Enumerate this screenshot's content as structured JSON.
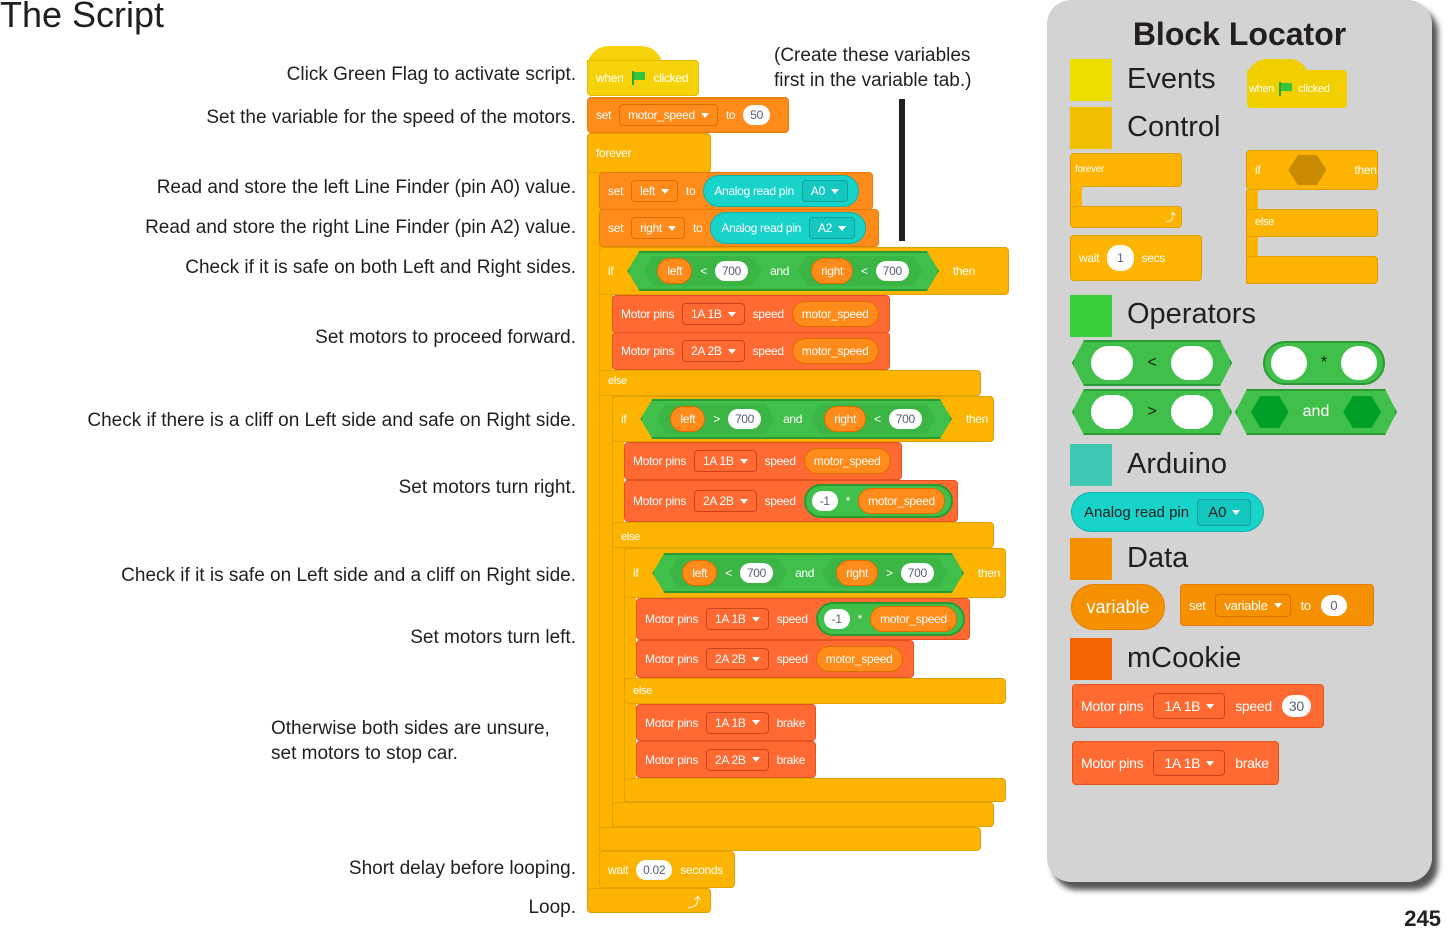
{
  "page": {
    "title": "The Script",
    "page_number": "245"
  },
  "note": {
    "line1": "(Create these variables",
    "line2": "first in the variable tab.)"
  },
  "annotations": [
    "Click Green Flag to activate script.",
    "Set the variable for the speed of the motors.",
    "Read and store the left Line Finder (pin A0) value.",
    "Read and store the right Line Finder (pin A2) value.",
    "Check if it is safe on both Left and Right sides.",
    "Set motors to proceed forward.",
    "Check if there is a cliff on Left side and safe on Right side.",
    "Set motors turn right.",
    "Check if it is safe on Left side and a cliff on Right side.",
    "Set motors turn left.",
    "Otherwise both sides are unsure,",
    "set motors to stop car.",
    "Short delay before looping.",
    "Loop."
  ],
  "script": {
    "hat": {
      "when": "when",
      "clicked": "clicked"
    },
    "set_speed": {
      "set": "set",
      "var": "motor_speed",
      "to": "to",
      "value": "50"
    },
    "forever": "forever",
    "set_left": {
      "set": "set",
      "var": "left",
      "to": "to",
      "reporter": "Analog read pin",
      "pin": "A0"
    },
    "set_right": {
      "set": "set",
      "var": "right",
      "to": "to",
      "reporter": "Analog read pin",
      "pin": "A2"
    },
    "if1": {
      "if": "if",
      "a": "left",
      "op_a": "<",
      "val_a": "700",
      "and": "and",
      "b": "right",
      "op_b": "<",
      "val_b": "700",
      "then": "then"
    },
    "if1_motor1": {
      "label": "Motor pins",
      "pins": "1A 1B",
      "speed": "speed",
      "value": "motor_speed"
    },
    "if1_motor2": {
      "label": "Motor pins",
      "pins": "2A 2B",
      "speed": "speed",
      "value": "motor_speed"
    },
    "else": "else",
    "if2": {
      "if": "if",
      "a": "left",
      "op_a": ">",
      "val_a": "700",
      "and": "and",
      "b": "right",
      "op_b": "<",
      "val_b": "700",
      "then": "then"
    },
    "if2_motor1": {
      "label": "Motor pins",
      "pins": "1A 1B",
      "speed": "speed",
      "value": "motor_speed"
    },
    "if2_motor2": {
      "label": "Motor pins",
      "pins": "2A 2B",
      "speed": "speed",
      "mult_num": "-1",
      "mult_op": "*",
      "value": "motor_speed"
    },
    "if3": {
      "if": "if",
      "a": "left",
      "op_a": "<",
      "val_a": "700",
      "and": "and",
      "b": "right",
      "op_b": ">",
      "val_b": "700",
      "then": "then"
    },
    "if3_motor1": {
      "label": "Motor pins",
      "pins": "1A 1B",
      "speed": "speed",
      "mult_num": "-1",
      "mult_op": "*",
      "value": "motor_speed"
    },
    "if3_motor2": {
      "label": "Motor pins",
      "pins": "2A 2B",
      "speed": "speed",
      "value": "motor_speed"
    },
    "brake1": {
      "label": "Motor pins",
      "pins": "1A 1B",
      "action": "brake"
    },
    "brake2": {
      "label": "Motor pins",
      "pins": "2A 2B",
      "action": "brake"
    },
    "wait": {
      "wait": "wait",
      "value": "0.02",
      "unit": "seconds"
    }
  },
  "locator": {
    "title": "Block Locator",
    "categories": [
      {
        "name": "Events",
        "color": "#ede000"
      },
      {
        "name": "Control",
        "color": "#f2c000"
      },
      {
        "name": "Operators",
        "color": "#3ccf3c"
      },
      {
        "name": "Arduino",
        "color": "#3ec8b4"
      },
      {
        "name": "Data",
        "color": "#f59000"
      },
      {
        "name": "mCookie",
        "color": "#f26500"
      }
    ],
    "events_block": {
      "when": "when",
      "clicked": "clicked"
    },
    "forever_block": "forever",
    "if_else_block": {
      "if": "if",
      "then": "then",
      "else": "else"
    },
    "wait_block": {
      "wait": "wait",
      "value": "1",
      "unit": "secs"
    },
    "op_lt": "<",
    "op_mul": "*",
    "op_gt": ">",
    "op_and": "and",
    "arduino_block": {
      "label": "Analog read pin",
      "pin": "A0"
    },
    "variable_reporter": "variable",
    "set_block": {
      "set": "set",
      "var": "variable",
      "to": "to",
      "value": "0"
    },
    "motor_speed_block": {
      "label": "Motor pins",
      "pins": "1A 1B",
      "speed": "speed",
      "value": "30"
    },
    "motor_brake_block": {
      "label": "Motor pins",
      "pins": "1A 1B",
      "action": "brake"
    }
  }
}
